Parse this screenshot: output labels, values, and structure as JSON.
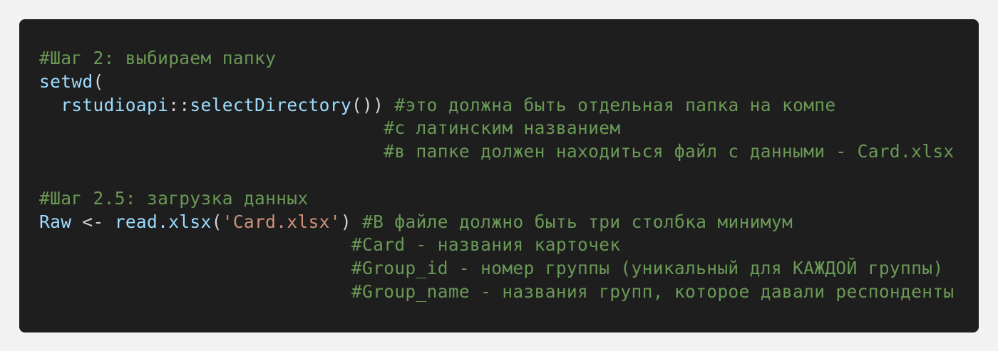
{
  "code": {
    "comment_step2": "#Шаг 2: выбираем папку",
    "setwd": "setwd",
    "paren_open": "(",
    "indent": "  ",
    "rstudioapi": "rstudioapi",
    "scope": "::",
    "selectDirectory": "selectDirectory",
    "call_close": "())",
    "comment_folder_1": "#это должна быть отдельная папка на компе",
    "comment_folder_2": "#с латинским названием",
    "comment_folder_3": "#в папке должен находиться файл с данными - Card.xlsx",
    "comment_step25": "#Шаг 2.5: загрузка данных",
    "raw": "Raw",
    "assign": " <- ",
    "read_xlsx": "read.xlsx",
    "string_card": "'Card.xlsx'",
    "paren_close": ")",
    "comment_file_1": "#В файле должно быть три столбка минимум",
    "comment_file_2": "#Card - названия карточек",
    "comment_file_3": "#Group_id - номер группы (уникальный для КАЖДОЙ группы)",
    "comment_file_4": "#Group_name - названия групп, которое давали респонденты"
  }
}
